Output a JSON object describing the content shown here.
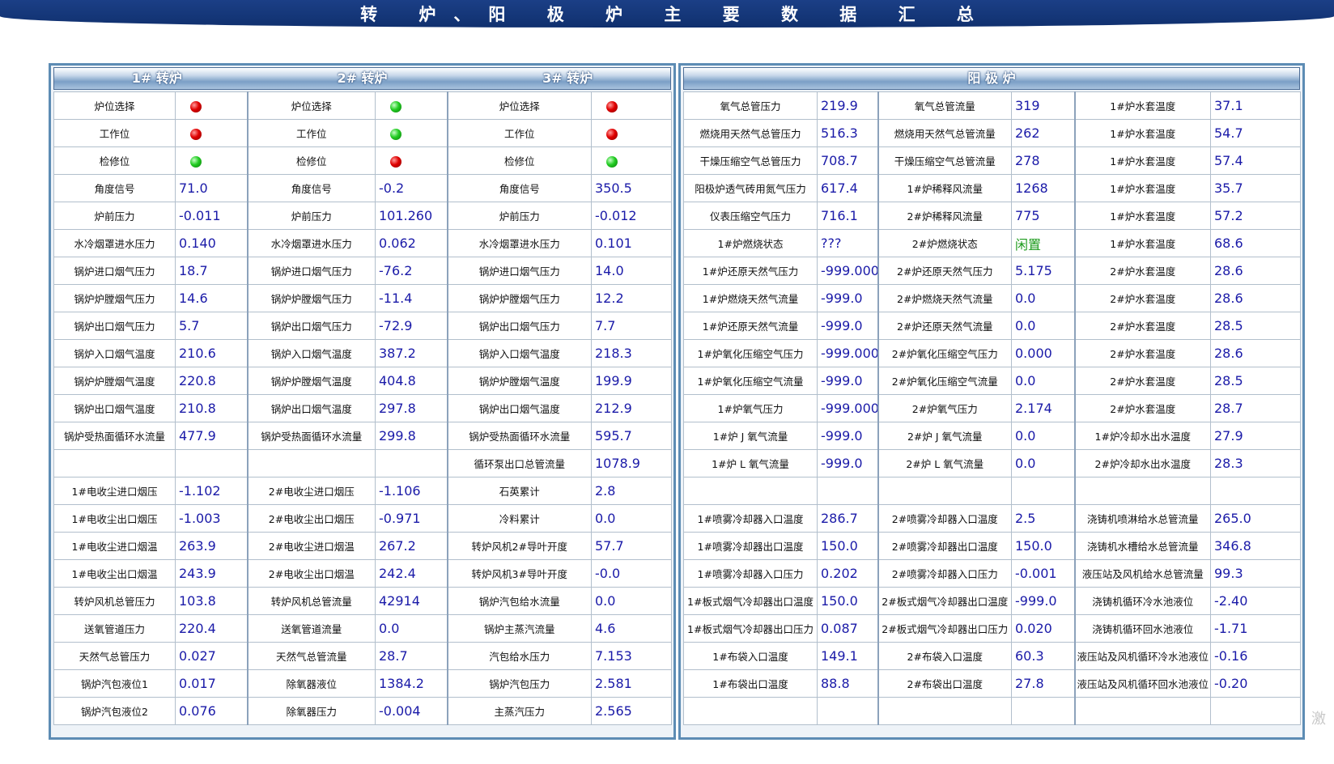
{
  "title": "转 炉、阳 极 炉 主 要 数 据 汇 总",
  "watermark": "激",
  "colors": {
    "title_bar": "#1b3f86",
    "value_text": "#1a1aa8",
    "status_green": "#1d9b1d",
    "indicator_red": "#e00000",
    "indicator_green": "#22cc22"
  },
  "converter": {
    "headers": [
      "1# 转炉",
      "2# 转炉",
      "3# 转炉"
    ],
    "rows": [
      [
        {
          "label": "炉位选择",
          "dot": "red"
        },
        {
          "label": "炉位选择",
          "dot": "green"
        },
        {
          "label": "炉位选择",
          "dot": "red"
        }
      ],
      [
        {
          "label": "工作位",
          "dot": "red"
        },
        {
          "label": "工作位",
          "dot": "green"
        },
        {
          "label": "工作位",
          "dot": "red"
        }
      ],
      [
        {
          "label": "检修位",
          "dot": "green"
        },
        {
          "label": "检修位",
          "dot": "red"
        },
        {
          "label": "检修位",
          "dot": "green"
        }
      ],
      [
        {
          "label": "角度信号",
          "value": "71.0"
        },
        {
          "label": "角度信号",
          "value": "-0.2"
        },
        {
          "label": "角度信号",
          "value": "350.5"
        }
      ],
      [
        {
          "label": "炉前压力",
          "value": "-0.011"
        },
        {
          "label": "炉前压力",
          "value": "101.260"
        },
        {
          "label": "炉前压力",
          "value": "-0.012"
        }
      ],
      [
        {
          "label": "水冷烟罩进水压力",
          "value": "0.140"
        },
        {
          "label": "水冷烟罩进水压力",
          "value": "0.062"
        },
        {
          "label": "水冷烟罩进水压力",
          "value": "0.101"
        }
      ],
      [
        {
          "label": "锅炉进口烟气压力",
          "value": "18.7"
        },
        {
          "label": "锅炉进口烟气压力",
          "value": "-76.2"
        },
        {
          "label": "锅炉进口烟气压力",
          "value": "14.0"
        }
      ],
      [
        {
          "label": "锅炉炉膛烟气压力",
          "value": "14.6"
        },
        {
          "label": "锅炉炉膛烟气压力",
          "value": "-11.4"
        },
        {
          "label": "锅炉炉膛烟气压力",
          "value": "12.2"
        }
      ],
      [
        {
          "label": "锅炉出口烟气压力",
          "value": "5.7"
        },
        {
          "label": "锅炉出口烟气压力",
          "value": "-72.9"
        },
        {
          "label": "锅炉出口烟气压力",
          "value": "7.7"
        }
      ],
      [
        {
          "label": "锅炉入口烟气温度",
          "value": "210.6"
        },
        {
          "label": "锅炉入口烟气温度",
          "value": "387.2"
        },
        {
          "label": "锅炉入口烟气温度",
          "value": "218.3"
        }
      ],
      [
        {
          "label": "锅炉炉膛烟气温度",
          "value": "220.8"
        },
        {
          "label": "锅炉炉膛烟气温度",
          "value": "404.8"
        },
        {
          "label": "锅炉炉膛烟气温度",
          "value": "199.9"
        }
      ],
      [
        {
          "label": "锅炉出口烟气温度",
          "value": "210.8"
        },
        {
          "label": "锅炉出口烟气温度",
          "value": "297.8"
        },
        {
          "label": "锅炉出口烟气温度",
          "value": "212.9"
        }
      ],
      [
        {
          "label": "锅炉受热面循环水流量",
          "value": "477.9"
        },
        {
          "label": "锅炉受热面循环水流量",
          "value": "299.8"
        },
        {
          "label": "锅炉受热面循环水流量",
          "value": "595.7"
        }
      ],
      [
        {
          "label": "",
          "value": ""
        },
        {
          "label": "",
          "value": ""
        },
        {
          "label": "循环泵出口总管流量",
          "value": "1078.9"
        }
      ],
      [
        {
          "label": "1#电收尘进口烟压",
          "value": "-1.102"
        },
        {
          "label": "2#电收尘进口烟压",
          "value": "-1.106"
        },
        {
          "label": "石英累计",
          "value": "2.8"
        }
      ],
      [
        {
          "label": "1#电收尘出口烟压",
          "value": "-1.003"
        },
        {
          "label": "2#电收尘出口烟压",
          "value": "-0.971"
        },
        {
          "label": "冷料累计",
          "value": "0.0"
        }
      ],
      [
        {
          "label": "1#电收尘进口烟温",
          "value": "263.9"
        },
        {
          "label": "2#电收尘进口烟温",
          "value": "267.2"
        },
        {
          "label": "转炉风机2#导叶开度",
          "value": "57.7"
        }
      ],
      [
        {
          "label": "1#电收尘出口烟温",
          "value": "243.9"
        },
        {
          "label": "2#电收尘出口烟温",
          "value": "242.4"
        },
        {
          "label": "转炉风机3#导叶开度",
          "value": "-0.0"
        }
      ],
      [
        {
          "label": "转炉风机总管压力",
          "value": "103.8"
        },
        {
          "label": "转炉风机总管流量",
          "value": "42914"
        },
        {
          "label": "锅炉汽包给水流量",
          "value": "0.0"
        }
      ],
      [
        {
          "label": "送氧管道压力",
          "value": "220.4"
        },
        {
          "label": "送氧管道流量",
          "value": "0.0"
        },
        {
          "label": "锅炉主蒸汽流量",
          "value": "4.6"
        }
      ],
      [
        {
          "label": "天然气总管压力",
          "value": "0.027"
        },
        {
          "label": "天然气总管流量",
          "value": "28.7"
        },
        {
          "label": "汽包给水压力",
          "value": "7.153"
        }
      ],
      [
        {
          "label": "锅炉汽包液位1",
          "value": "0.017"
        },
        {
          "label": "除氧器液位",
          "value": "1384.2"
        },
        {
          "label": "锅炉汽包压力",
          "value": "2.581"
        }
      ],
      [
        {
          "label": "锅炉汽包液位2",
          "value": "0.076"
        },
        {
          "label": "除氧器压力",
          "value": "-0.004"
        },
        {
          "label": "主蒸汽压力",
          "value": "2.565"
        }
      ]
    ]
  },
  "anode": {
    "header": "阳 极 炉",
    "rows": [
      [
        {
          "label": "氧气总管压力",
          "value": "219.9"
        },
        {
          "label": "氧气总管流量",
          "value": "319"
        },
        {
          "label": "1#炉水套温度",
          "value": "37.1"
        }
      ],
      [
        {
          "label": "燃烧用天然气总管压力",
          "value": "516.3"
        },
        {
          "label": "燃烧用天然气总管流量",
          "value": "262"
        },
        {
          "label": "1#炉水套温度",
          "value": "54.7"
        }
      ],
      [
        {
          "label": "干燥压缩空气总管压力",
          "value": "708.7"
        },
        {
          "label": "干燥压缩空气总管流量",
          "value": "278"
        },
        {
          "label": "1#炉水套温度",
          "value": "57.4"
        }
      ],
      [
        {
          "label": "阳极炉透气砖用氮气压力",
          "value": "617.4"
        },
        {
          "label": "1#炉稀释风流量",
          "value": "1268"
        },
        {
          "label": "1#炉水套温度",
          "value": "35.7"
        }
      ],
      [
        {
          "label": "仪表压缩空气压力",
          "value": "716.1"
        },
        {
          "label": "2#炉稀释风流量",
          "value": "775"
        },
        {
          "label": "1#炉水套温度",
          "value": "57.2"
        }
      ],
      [
        {
          "label": "1#炉燃烧状态",
          "value": "???"
        },
        {
          "label": "2#炉燃烧状态",
          "value": "闲置",
          "green": true
        },
        {
          "label": "1#炉水套温度",
          "value": "68.6"
        }
      ],
      [
        {
          "label": "1#炉还原天然气压力",
          "value": "-999.000"
        },
        {
          "label": "2#炉还原天然气压力",
          "value": "5.175"
        },
        {
          "label": "2#炉水套温度",
          "value": "28.6"
        }
      ],
      [
        {
          "label": "1#炉燃烧天然气流量",
          "value": "-999.0"
        },
        {
          "label": "2#炉燃烧天然气流量",
          "value": "0.0"
        },
        {
          "label": "2#炉水套温度",
          "value": "28.6"
        }
      ],
      [
        {
          "label": "1#炉还原天然气流量",
          "value": "-999.0"
        },
        {
          "label": "2#炉还原天然气流量",
          "value": "0.0"
        },
        {
          "label": "2#炉水套温度",
          "value": "28.5"
        }
      ],
      [
        {
          "label": "1#炉氧化压缩空气压力",
          "value": "-999.000"
        },
        {
          "label": "2#炉氧化压缩空气压力",
          "value": "0.000"
        },
        {
          "label": "2#炉水套温度",
          "value": "28.6"
        }
      ],
      [
        {
          "label": "1#炉氧化压缩空气流量",
          "value": "-999.0"
        },
        {
          "label": "2#炉氧化压缩空气流量",
          "value": "0.0"
        },
        {
          "label": "2#炉水套温度",
          "value": "28.5"
        }
      ],
      [
        {
          "label": "1#炉氧气压力",
          "value": "-999.000"
        },
        {
          "label": "2#炉氧气压力",
          "value": "2.174"
        },
        {
          "label": "2#炉水套温度",
          "value": "28.7"
        }
      ],
      [
        {
          "label": "1#炉 J 氧气流量",
          "value": "-999.0"
        },
        {
          "label": "2#炉 J 氧气流量",
          "value": "0.0"
        },
        {
          "label": "1#炉冷却水出水温度",
          "value": "27.9"
        }
      ],
      [
        {
          "label": "1#炉 L 氧气流量",
          "value": "-999.0"
        },
        {
          "label": "2#炉 L 氧气流量",
          "value": "0.0"
        },
        {
          "label": "2#炉冷却水出水温度",
          "value": "28.3"
        }
      ],
      [
        {
          "label": "",
          "value": ""
        },
        {
          "label": "",
          "value": ""
        },
        {
          "label": "",
          "value": ""
        }
      ],
      [
        {
          "label": "1#喷雾冷却器入口温度",
          "value": "286.7"
        },
        {
          "label": "2#喷雾冷却器入口温度",
          "value": "2.5"
        },
        {
          "label": "浇铸机喷淋给水总管流量",
          "value": "265.0"
        }
      ],
      [
        {
          "label": "1#喷雾冷却器出口温度",
          "value": "150.0"
        },
        {
          "label": "2#喷雾冷却器出口温度",
          "value": "150.0"
        },
        {
          "label": "浇铸机水槽给水总管流量",
          "value": "346.8"
        }
      ],
      [
        {
          "label": "1#喷雾冷却器入口压力",
          "value": "0.202"
        },
        {
          "label": "2#喷雾冷却器入口压力",
          "value": "-0.001"
        },
        {
          "label": "液压站及风机给水总管流量",
          "value": "99.3"
        }
      ],
      [
        {
          "label": "1#板式烟气冷却器出口温度",
          "value": "150.0"
        },
        {
          "label": "2#板式烟气冷却器出口温度",
          "value": "-999.0"
        },
        {
          "label": "浇铸机循环冷水池液位",
          "value": "-2.40"
        }
      ],
      [
        {
          "label": "1#板式烟气冷却器出口压力",
          "value": "0.087"
        },
        {
          "label": "2#板式烟气冷却器出口压力",
          "value": "0.020"
        },
        {
          "label": "浇铸机循环回水池液位",
          "value": "-1.71"
        }
      ],
      [
        {
          "label": "1#布袋入口温度",
          "value": "149.1"
        },
        {
          "label": "2#布袋入口温度",
          "value": "60.3"
        },
        {
          "label": "液压站及风机循环冷水池液位",
          "value": "-0.16"
        }
      ],
      [
        {
          "label": "1#布袋出口温度",
          "value": "88.8"
        },
        {
          "label": "2#布袋出口温度",
          "value": "27.8"
        },
        {
          "label": "液压站及风机循环回水池液位",
          "value": "-0.20"
        }
      ],
      [
        {
          "label": "",
          "value": ""
        },
        {
          "label": "",
          "value": ""
        },
        {
          "label": "",
          "value": ""
        }
      ]
    ]
  }
}
